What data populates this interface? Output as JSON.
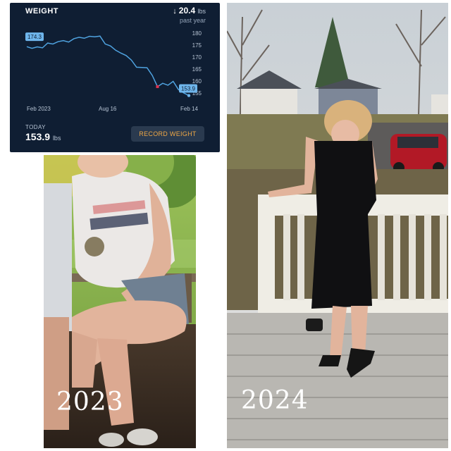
{
  "card": {
    "title": "WEIGHT",
    "delta_arrow": "↓",
    "delta_value": "20.4",
    "delta_unit": "lbs",
    "period": "past year",
    "today_label": "TODAY",
    "today_value": "153.9",
    "today_unit": "lbs",
    "record_button": "RECORD WEIGHT",
    "start_badge": "174.3",
    "end_badge": "153.9",
    "x_labels": [
      "Feb 2023",
      "Aug 16",
      "Feb 14"
    ],
    "y_labels": [
      "180",
      "175",
      "170",
      "165",
      "160",
      "155"
    ],
    "colors": {
      "card_bg": "#0f1e33",
      "line": "#4fa3e0",
      "button_text": "#f0a845",
      "marker": "#e0334f"
    }
  },
  "chart_data": {
    "type": "line",
    "x_labels": [
      "Feb 2023",
      "Aug 16",
      "Feb 14"
    ],
    "y_range": [
      152,
      182
    ],
    "y_ticks": [
      180,
      175,
      170,
      165,
      160,
      155
    ],
    "series": [
      {
        "values": [
          174.3,
          173.6,
          174.2,
          173.8,
          175.8,
          175.4,
          176.4,
          176.8,
          176.2,
          177.6,
          178.2,
          177.8,
          178.6,
          178.4,
          178.7,
          175.4,
          174.6,
          172.8,
          171.6,
          170.6,
          168.7,
          165.7,
          165.6,
          165.5,
          162.3,
          157.6,
          159.0,
          158.2,
          159.8,
          156.4,
          155.0,
          153.9
        ]
      }
    ],
    "grid": false
  },
  "photos": {
    "left_year": "2023",
    "right_year": "2024",
    "colors": {
      "shirt": "#ebe8e6",
      "skin": "#e2b49c",
      "dress": "#101012",
      "railing": "#efede5",
      "deck": "#b9b7b2",
      "car": "#b21926"
    }
  }
}
